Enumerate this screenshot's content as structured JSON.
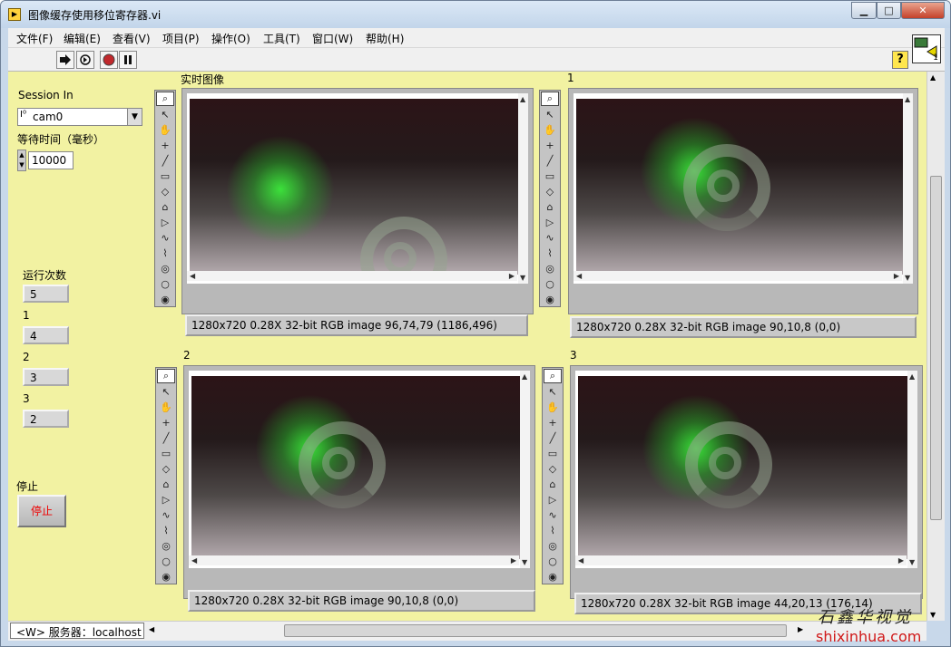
{
  "window": {
    "title": "图像缓存使用移位寄存器.vi",
    "buttons": {
      "minimize": "▁",
      "maximize": "□",
      "close": "✕"
    }
  },
  "menu": [
    "文件(F)",
    "编辑(E)",
    "查看(V)",
    "项目(P)",
    "操作(O)",
    "工具(T)",
    "窗口(W)",
    "帮助(H)"
  ],
  "toolbar": {
    "help": "?",
    "icon_badge": "1"
  },
  "controls": {
    "session_label": "Session In",
    "session_value": "cam0",
    "timeout_label": "等待时间（毫秒）",
    "timeout_value": "10000",
    "runs_label": "运行次数",
    "runs_value": "5",
    "ind1_label": "1",
    "ind1_value": "4",
    "ind2_label": "2",
    "ind2_value": "3",
    "ind3_label": "3",
    "ind3_value": "2",
    "stop_label": "停止",
    "stop_button": "停止"
  },
  "images": [
    {
      "title": "实时图像",
      "info": "1280x720 0.28X 32-bit RGB image 96,74,79    (1186,496)"
    },
    {
      "title": "1",
      "info": "1280x720 0.28X 32-bit RGB image 90,10,8     (0,0)"
    },
    {
      "title": "2",
      "info": "1280x720 0.28X 32-bit RGB image 90,10,8     (0,0)"
    },
    {
      "title": "3",
      "info": "1280x720 0.28X 32-bit RGB image 44,20,13    (176,14)"
    }
  ],
  "palette_icons": [
    "zoom-icon",
    "pointer-icon",
    "pan-icon",
    "point-icon",
    "line-icon",
    "rectangle-icon",
    "rotated-rect-icon",
    "polygon-icon",
    "broken-line-icon",
    "freehand-icon",
    "freehand-region-icon",
    "closed-freehand-icon",
    "oval-icon",
    "annulus-icon"
  ],
  "status": {
    "server": "<W> 服务器：localhost"
  },
  "watermark": {
    "brand": "石鑫华视觉",
    "url": "shixinhua.com"
  },
  "colors": {
    "panel": "#f2f2a2",
    "stop_text": "#e00000"
  }
}
